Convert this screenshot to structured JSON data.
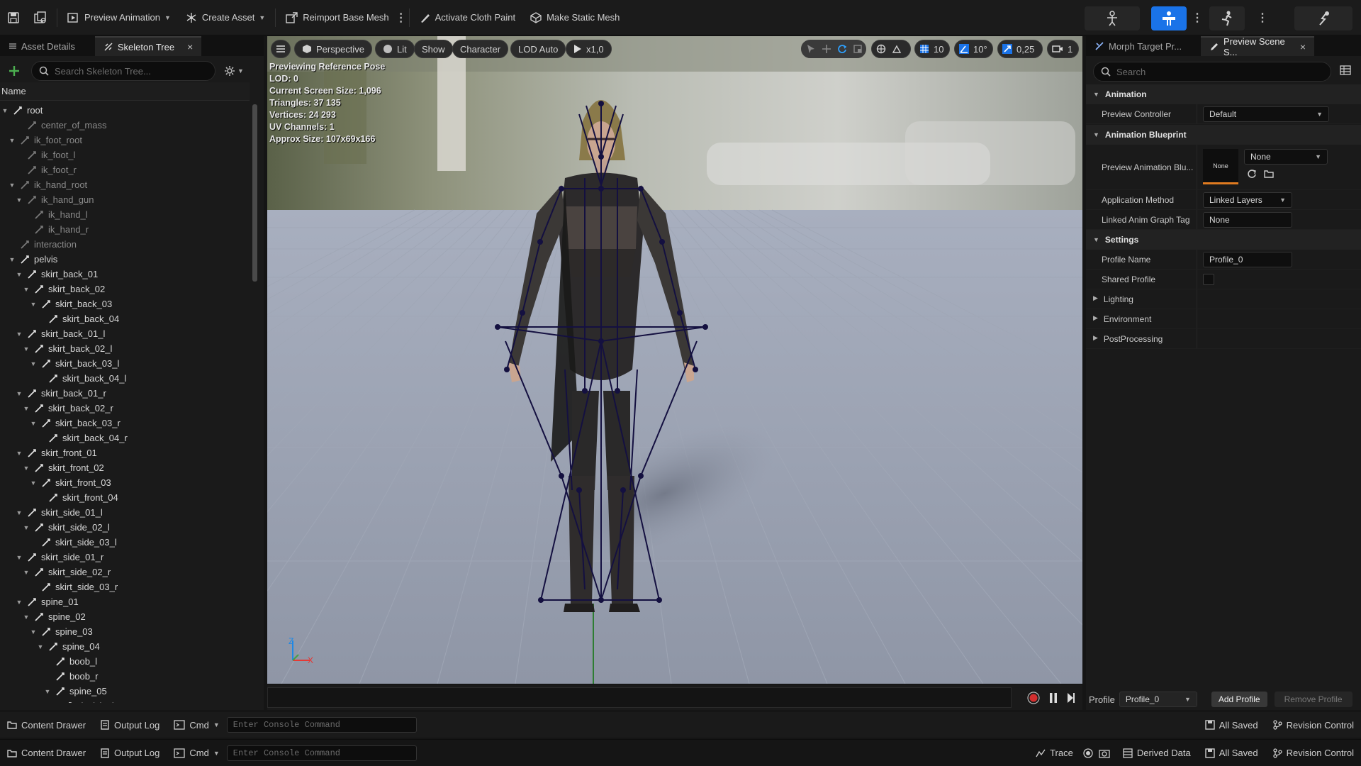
{
  "toolbar": {
    "preview_animation": "Preview Animation",
    "create_asset": "Create Asset",
    "reimport_base_mesh": "Reimport Base Mesh",
    "activate_cloth_paint": "Activate Cloth Paint",
    "make_static_mesh": "Make Static Mesh"
  },
  "left_panel": {
    "tabs": [
      "Asset Details",
      "Skeleton Tree"
    ],
    "search_placeholder": "Search Skeleton Tree...",
    "column_header": "Name",
    "bones": [
      "root",
      "center_of_mass",
      "ik_foot_root",
      "ik_foot_l",
      "ik_foot_r",
      "ik_hand_root",
      "ik_hand_gun",
      "ik_hand_l",
      "ik_hand_r",
      "interaction",
      "pelvis",
      "skirt_back_01",
      "skirt_back_02",
      "skirt_back_03",
      "skirt_back_04",
      "skirt_back_01_l",
      "skirt_back_02_l",
      "skirt_back_03_l",
      "skirt_back_04_l",
      "skirt_back_01_r",
      "skirt_back_02_r",
      "skirt_back_03_r",
      "skirt_back_04_r",
      "skirt_front_01",
      "skirt_front_02",
      "skirt_front_03",
      "skirt_front_04",
      "skirt_side_01_l",
      "skirt_side_02_l",
      "skirt_side_03_l",
      "skirt_side_01_r",
      "skirt_side_02_r",
      "skirt_side_03_r",
      "spine_01",
      "spine_02",
      "spine_03",
      "spine_04",
      "boob_l",
      "boob_r",
      "spine_05",
      "clavicle_l"
    ]
  },
  "viewport": {
    "buttons": {
      "perspective": "Perspective",
      "lit": "Lit",
      "show": "Show",
      "character": "Character",
      "lod": "LOD Auto",
      "speed": "x1,0"
    },
    "snap": {
      "grid": "10",
      "angle": "10°",
      "scale": "0,25",
      "camera_speed": "1"
    },
    "stats": [
      "Previewing Reference Pose",
      "LOD: 0",
      "Current Screen Size: 1,096",
      "Triangles: 37 135",
      "Vertices: 24 293",
      "UV Channels: 1",
      "Approx Size: 107x69x166"
    ],
    "axis": {
      "z": "Z",
      "x": "X"
    }
  },
  "right_panel": {
    "tabs": [
      "Morph Target Pr...",
      "Preview Scene S..."
    ],
    "search_placeholder": "Search",
    "sections": {
      "animation": "Animation",
      "animation_blueprint": "Animation Blueprint",
      "settings": "Settings"
    },
    "props": {
      "preview_controller_label": "Preview Controller",
      "preview_controller_value": "Default",
      "preview_anim_bp_label": "Preview Animation Blu...",
      "preview_anim_bp_thumb": "None",
      "preview_anim_bp_value": "None",
      "application_method_label": "Application Method",
      "application_method_value": "Linked Layers",
      "linked_anim_graph_tag_label": "Linked Anim Graph Tag",
      "linked_anim_graph_tag_value": "None",
      "profile_name_label": "Profile Name",
      "profile_name_value": "Profile_0",
      "shared_profile_label": "Shared Profile",
      "lighting": "Lighting",
      "environment": "Environment",
      "postprocessing": "PostProcessing"
    },
    "profile_bar": {
      "label": "Profile",
      "value": "Profile_0",
      "add": "Add Profile",
      "remove": "Remove Profile"
    }
  },
  "statusbar": {
    "content_drawer": "Content Drawer",
    "output_log": "Output Log",
    "cmd": "Cmd",
    "console_placeholder": "Enter Console Command",
    "trace": "Trace",
    "derived_data": "Derived Data",
    "all_saved": "All Saved",
    "revision_control": "Revision Control"
  },
  "colors": {
    "accent": "#1a73e8",
    "skeleton": "#141040",
    "record": "#d32f2f"
  }
}
